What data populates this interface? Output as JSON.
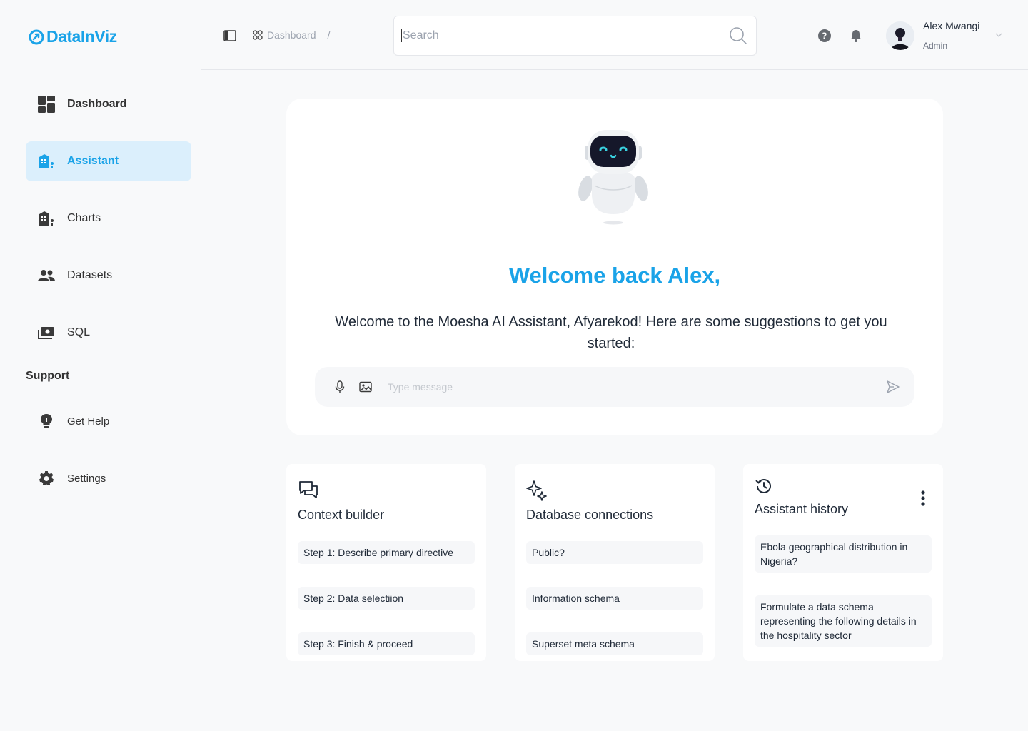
{
  "app": {
    "logo_text": "DataInViz",
    "brand_color": "#1aa3e8"
  },
  "sidebar": {
    "items": [
      {
        "label": "Dashboard",
        "icon": "dashboard-icon"
      },
      {
        "label": "Assistant",
        "icon": "assistant-icon",
        "active": true
      },
      {
        "label": "Charts",
        "icon": "charts-icon"
      },
      {
        "label": "Datasets",
        "icon": "people-icon"
      },
      {
        "label": "SQL",
        "icon": "sql-icon"
      }
    ],
    "support_title": "Support",
    "support_items": [
      {
        "label": "Get Help",
        "icon": "lightbulb-icon"
      },
      {
        "label": "Settings",
        "icon": "gear-icon"
      }
    ]
  },
  "header": {
    "breadcrumb": {
      "label": "Dashboard",
      "separator": "/"
    },
    "search": {
      "placeholder": "Search",
      "value": ""
    },
    "user": {
      "name": "Alex Mwangi",
      "role": "Admin"
    }
  },
  "main": {
    "welcome_title": "Welcome back Alex,",
    "welcome_subtitle": "Welcome to the Moesha AI Assistant, Afyarekod! Here are some suggestions to get you started:",
    "message_placeholder": "Type message"
  },
  "cards": {
    "context_builder": {
      "title": "Context builder",
      "items": [
        "Step 1: Describe primary directive",
        "Step 2: Data selectiion",
        "Step 3: Finish & proceed"
      ]
    },
    "database_connections": {
      "title": "Database connections",
      "items": [
        "Public?",
        "Information schema",
        "Superset meta schema"
      ]
    },
    "assistant_history": {
      "title": "Assistant history",
      "items": [
        "Ebola geographical distribution in Nigeria?",
        "Formulate a data schema representing the following details in the hospitality sector"
      ]
    }
  }
}
